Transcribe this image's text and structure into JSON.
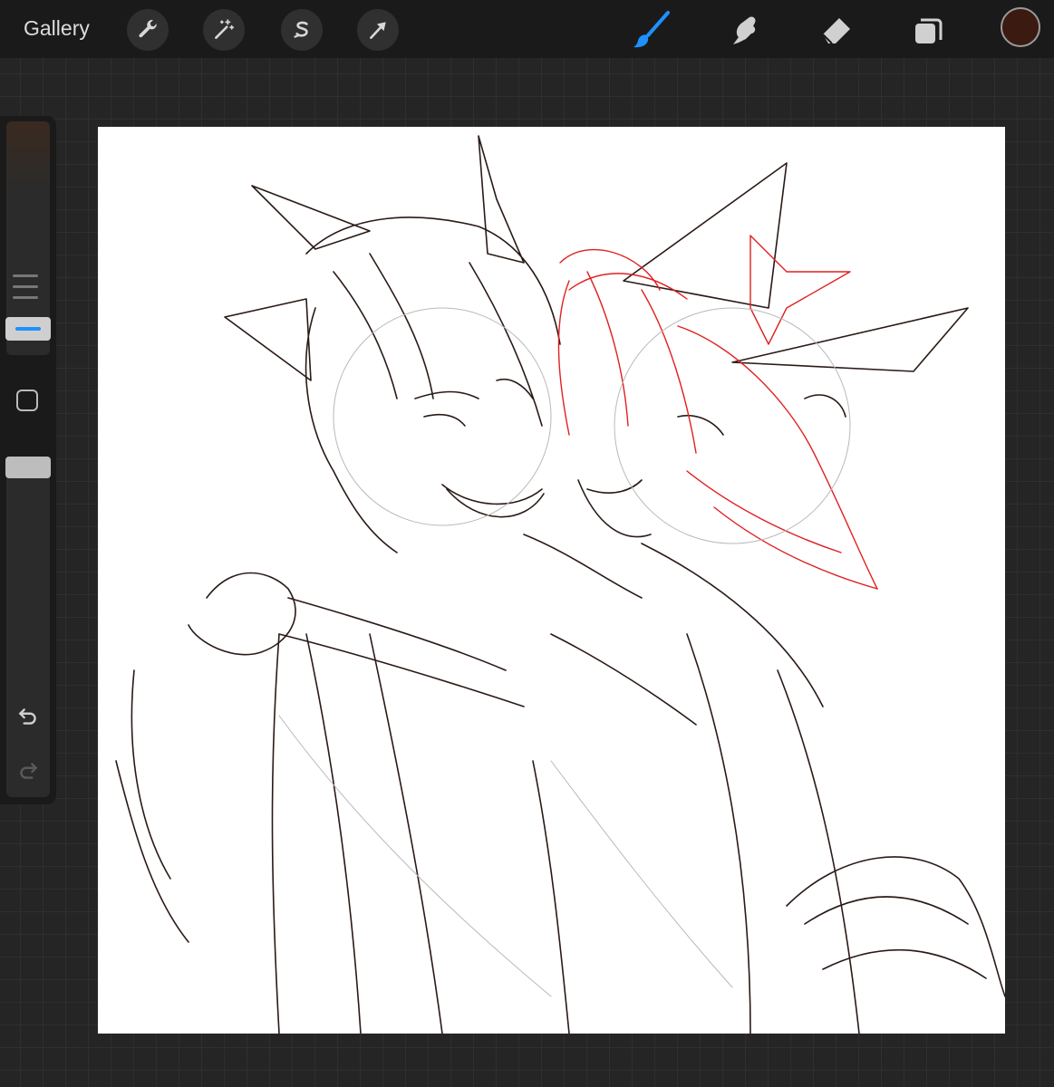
{
  "topbar": {
    "gallery_label": "Gallery",
    "left_tools": [
      "wrench-icon",
      "magic-wand-icon",
      "selection-s-icon",
      "transform-arrow-icon"
    ],
    "right_tools": [
      "brush-icon",
      "smudge-icon",
      "eraser-icon",
      "layers-icon"
    ],
    "active_tool": "brush-icon",
    "active_color": "#3b1a12",
    "accent_color": "#1e90ff"
  },
  "sidebar": {
    "controls": [
      "brush-size-slider",
      "modify-button",
      "opacity-slider",
      "undo-icon",
      "redo-icon"
    ]
  },
  "canvas": {
    "background": "#ffffff",
    "content": "sketch"
  }
}
